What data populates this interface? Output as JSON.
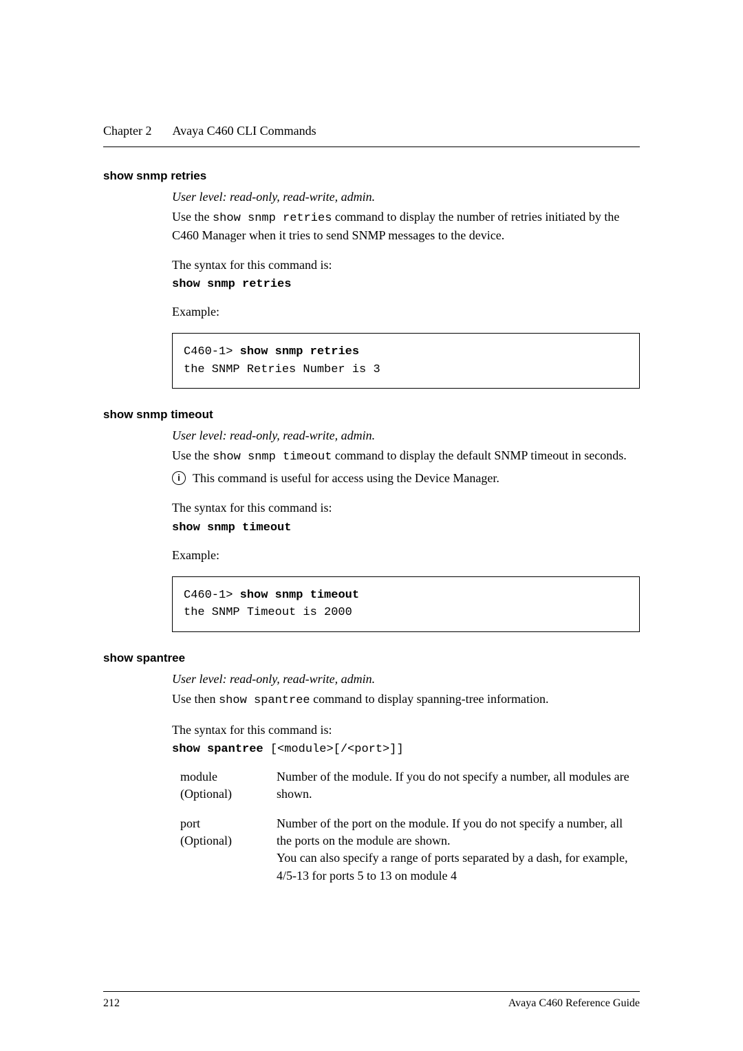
{
  "header": {
    "chapter": "Chapter 2",
    "title": "Avaya C460 CLI Commands"
  },
  "sections": [
    {
      "heading": "show snmp retries",
      "user_level": "User level: read-only, read-write, admin.",
      "intro_prefix": "Use the ",
      "intro_cmd": "show snmp retries",
      "intro_suffix": " command to display the number of retries initiated by the C460 Manager when it tries to send SNMP messages to the device.",
      "syntax_label": "The syntax for this command is:",
      "syntax_cmd": "show snmp retries",
      "example_label": "Example:",
      "code_prompt": "C460-1> ",
      "code_cmd": "show snmp retries",
      "code_output": "the SNMP Retries Number is 3"
    },
    {
      "heading": "show snmp timeout",
      "user_level": "User level: read-only, read-write, admin.",
      "intro_prefix": "Use the ",
      "intro_cmd": "show snmp timeout",
      "intro_suffix": " command to display the default SNMP timeout in seconds.",
      "info_note": "This command is useful for access using the Device Manager.",
      "syntax_label": "The syntax for this command is:",
      "syntax_cmd": "show snmp timeout",
      "example_label": "Example:",
      "code_prompt": "C460-1> ",
      "code_cmd": "show snmp timeout",
      "code_output": "the SNMP Timeout is 2000"
    },
    {
      "heading": "show spantree",
      "user_level": "User level: read-only, read-write, admin.",
      "intro_prefix": "Use then ",
      "intro_cmd": "show spantree",
      "intro_suffix": " command to display spanning-tree information.",
      "syntax_label": "The syntax for this command is:",
      "syntax_cmd": "show spantree",
      "syntax_args": " [<module>[/<port>]]",
      "params": [
        {
          "name": "module",
          "opt": "(Optional)",
          "desc": "Number of the module. If you do not specify a number, all modules are shown."
        },
        {
          "name": "port",
          "opt": "(Optional)",
          "desc": "Number of the port on the module. If you do not specify a number, all the ports on the module are shown.\nYou can also specify a range of ports separated by a dash, for example, 4/5-13 for ports 5 to 13 on module 4"
        }
      ]
    }
  ],
  "footer": {
    "page": "212",
    "doc": "Avaya C460 Reference Guide"
  },
  "icons": {
    "info": "i"
  }
}
